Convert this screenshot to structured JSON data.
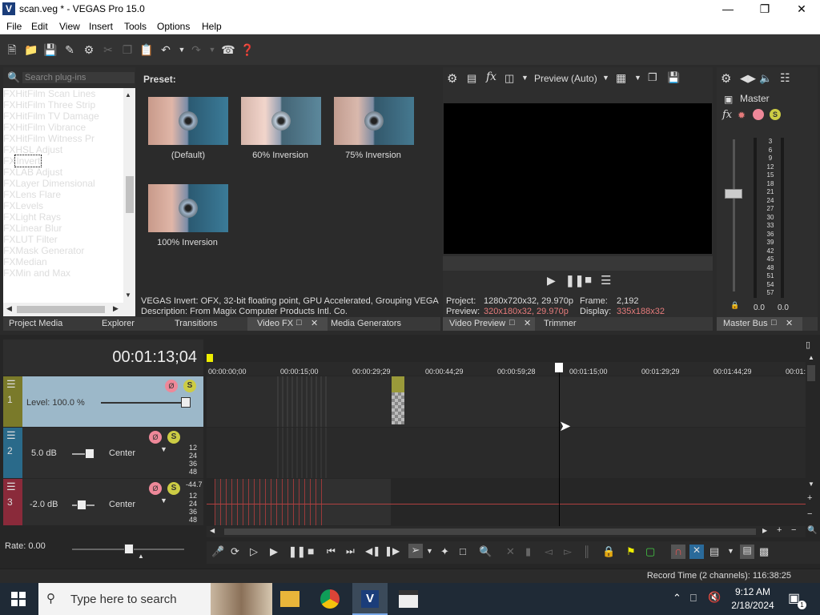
{
  "window": {
    "title": "scan.veg * - VEGAS Pro 15.0",
    "app_icon": "V"
  },
  "menu": [
    "File",
    "Edit",
    "View",
    "Insert",
    "Tools",
    "Options",
    "Help"
  ],
  "plugins": {
    "search_placeholder": "Search plug-ins",
    "items": [
      "HitFilm Scan Lines",
      "HitFilm Three Strip",
      "HitFilm TV Damage",
      "HitFilm Vibrance",
      "HitFilm Witness Pr",
      "HSL Adjust",
      "Invert",
      "LAB Adjust",
      "Layer Dimensional",
      "Lens Flare",
      "Levels",
      "Light Rays",
      "Linear Blur",
      "LUT Filter",
      "Mask Generator",
      "Median",
      "Min and Max"
    ],
    "fx_badge": "FX",
    "selected": "Invert"
  },
  "preset": {
    "label": "Preset:",
    "items": [
      "(Default)",
      "60% Inversion",
      "75% Inversion",
      "100% Inversion"
    ],
    "info_line1": "VEGAS Invert: OFX, 32-bit floating point, GPU Accelerated, Grouping VEGAS\\",
    "info_line2": "Description: From Magix Computer Products Intl. Co."
  },
  "left_tabs": [
    "Project Media",
    "Explorer",
    "Transitions",
    "Video FX",
    "Media Generators"
  ],
  "preview": {
    "mode": "Preview (Auto)",
    "project_label": "Project:",
    "project_value": "1280x720x32, 29.970p",
    "frame_label": "Frame:",
    "frame_value": "2,192",
    "preview_label": "Preview:",
    "preview_value": "320x180x32, 29.970p",
    "display_label": "Display:",
    "display_value": "335x188x32",
    "tabs": [
      "Video Preview",
      "Trimmer"
    ]
  },
  "master": {
    "label": "Master",
    "scale": [
      "3",
      "6",
      "9",
      "12",
      "15",
      "18",
      "21",
      "24",
      "27",
      "30",
      "33",
      "36",
      "39",
      "42",
      "45",
      "48",
      "51",
      "54",
      "57"
    ],
    "left_value": "0.0",
    "right_value": "0.0",
    "tab": "Master Bus"
  },
  "timeline": {
    "timecode": "00:01:13;04",
    "ruler": [
      "00:00:00;00",
      "00:00:15;00",
      "00:00:29;29",
      "00:00:44;29",
      "00:00:59;28",
      "00:01:15;00",
      "00:01:29;29",
      "00:01:44;29",
      "00:01:"
    ],
    "tracks": [
      {
        "num": "1",
        "label": "Level: 100.0 %"
      },
      {
        "num": "2",
        "label": "5.0 dB",
        "pan": "Center",
        "meter": [
          "12",
          "24",
          "36",
          "48"
        ]
      },
      {
        "num": "3",
        "label": "-2.0 dB",
        "pan": "Center",
        "peak": "-44.7",
        "meter": [
          "12",
          "24",
          "36",
          "48"
        ]
      }
    ],
    "rate": "Rate: 0.00"
  },
  "status": {
    "record_time": "Record Time (2 channels): 116:38:25"
  },
  "taskbar": {
    "search_placeholder": "Type here to search",
    "time": "9:12 AM",
    "date": "2/18/2024",
    "notif_count": "1",
    "apps": [
      "file-explorer",
      "chrome",
      "vegas",
      "clapper"
    ]
  },
  "colors": {
    "accent": "#1f4db8",
    "track1": "#9cb8c9",
    "track1_side": "#7a7a2a",
    "track2_side": "#2a6a8a",
    "track3_side": "#8a2a3a"
  }
}
